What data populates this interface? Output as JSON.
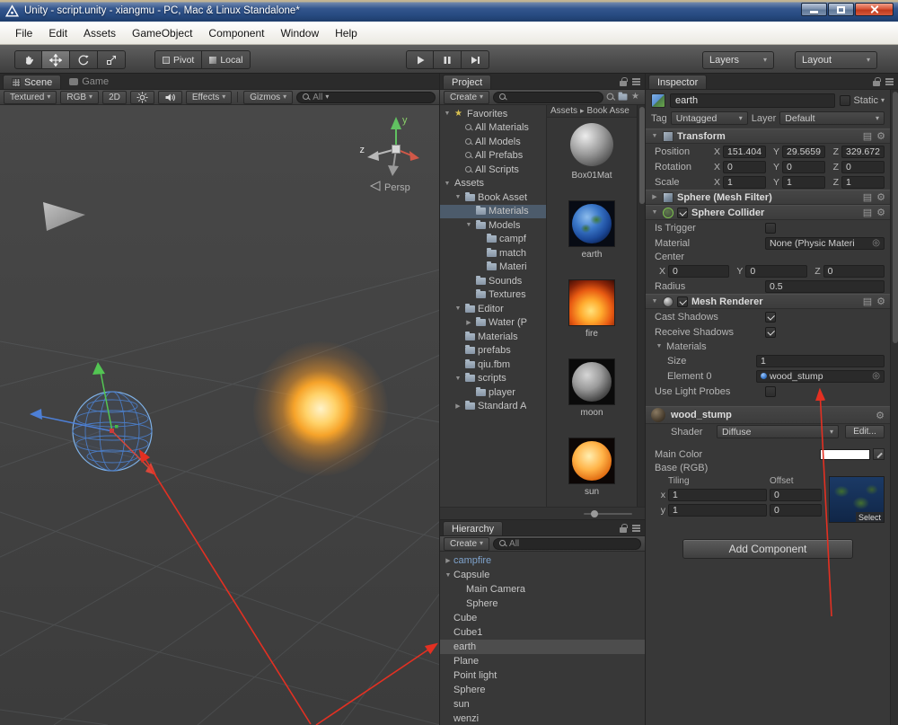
{
  "window": {
    "title": "Unity - script.unity - xiangmu - PC, Mac & Linux Standalone*"
  },
  "icons": {
    "dropdown": "▾",
    "gear": "⚙",
    "book": "▤",
    "picker": "◎",
    "star": "★",
    "breadcrumb_sep": "▸"
  },
  "menu": {
    "items": [
      {
        "label": "File"
      },
      {
        "label": "Edit"
      },
      {
        "label": "Assets"
      },
      {
        "label": "GameObject"
      },
      {
        "label": "Component"
      },
      {
        "label": "Window"
      },
      {
        "label": "Help"
      }
    ]
  },
  "toolbar": {
    "pivot": "Pivot",
    "local": "Local",
    "layers": "Layers",
    "layout": "Layout"
  },
  "scene": {
    "tab_scene": "Scene",
    "tab_game": "Game",
    "btn_textured": "Textured",
    "btn_rgb": "RGB",
    "btn_2d": "2D",
    "btn_effects": "Effects",
    "btn_gizmos": "Gizmos",
    "search": "All",
    "axis_y": "y",
    "axis_z": "z",
    "persp": "Persp"
  },
  "project": {
    "tab": "Project",
    "create": "Create",
    "breadcrumb_root": "Assets",
    "breadcrumb_current": "Book Asse",
    "tree": [
      {
        "label": "Favorites"
      },
      {
        "label": "All Materials"
      },
      {
        "label": "All Models"
      },
      {
        "label": "All Prefabs"
      },
      {
        "label": "All Scripts"
      },
      {
        "label": "Assets"
      },
      {
        "label": "Book Asset"
      },
      {
        "label": "Materials"
      },
      {
        "label": "Models"
      },
      {
        "label": "campf"
      },
      {
        "label": "match"
      },
      {
        "label": "Materi"
      },
      {
        "label": "Sounds"
      },
      {
        "label": "Textures"
      },
      {
        "label": "Editor"
      },
      {
        "label": "Water (P"
      },
      {
        "label": "Materials"
      },
      {
        "label": "prefabs"
      },
      {
        "label": "qiu.fbm"
      },
      {
        "label": "scripts"
      },
      {
        "label": "player"
      },
      {
        "label": "Standard A"
      }
    ],
    "assets": [
      {
        "name": "Box01Mat"
      },
      {
        "name": "earth"
      },
      {
        "name": "fire"
      },
      {
        "name": "moon"
      },
      {
        "name": "sun"
      }
    ]
  },
  "hierarchy": {
    "tab": "Hierarchy",
    "create": "Create",
    "search": "All",
    "items": [
      {
        "label": "campfire"
      },
      {
        "label": "Capsule"
      },
      {
        "label": "Main Camera"
      },
      {
        "label": "Sphere"
      },
      {
        "label": "Cube"
      },
      {
        "label": "Cube1"
      },
      {
        "label": "earth"
      },
      {
        "label": "Plane"
      },
      {
        "label": "Point light"
      },
      {
        "label": "Sphere"
      },
      {
        "label": "sun"
      },
      {
        "label": "wenzi"
      }
    ]
  },
  "inspector": {
    "tab": "Inspector",
    "name": "earth",
    "static_label": "Static",
    "tag_label": "Tag",
    "tag_value": "Untagged",
    "layer_label": "Layer",
    "layer_value": "Default",
    "axis_x": "X",
    "axis_y": "Y",
    "axis_z": "Z",
    "transform": {
      "title": "Transform",
      "position": {
        "label": "Position",
        "x": "151.404",
        "y": "29.5659",
        "z": "329.672"
      },
      "rotation": {
        "label": "Rotation",
        "x": "0",
        "y": "0",
        "z": "0"
      },
      "scale": {
        "label": "Scale",
        "x": "1",
        "y": "1",
        "z": "1"
      }
    },
    "mesh_filter": {
      "title": "Sphere (Mesh Filter)"
    },
    "sphere_collider": {
      "title": "Sphere Collider",
      "is_trigger_label": "Is Trigger",
      "material_label": "Material",
      "material_value": "None (Physic Materi",
      "center_label": "Center",
      "center": {
        "x": "0",
        "y": "0",
        "z": "0"
      },
      "radius_label": "Radius",
      "radius_value": "0.5"
    },
    "mesh_renderer": {
      "title": "Mesh Renderer",
      "cast_label": "Cast Shadows",
      "receive_label": "Receive Shadows",
      "materials_label": "Materials",
      "size_label": "Size",
      "size_value": "1",
      "element_label": "Element 0",
      "element_value": "wood_stump",
      "probes_label": "Use Light Probes"
    },
    "material": {
      "name": "wood_stump",
      "shader_label": "Shader",
      "shader_value": "Diffuse",
      "edit_label": "Edit...",
      "main_color_label": "Main Color",
      "base_label": "Base (RGB)",
      "tiling_label": "Tiling",
      "offset_label": "Offset",
      "x_label": "x",
      "y_label": "y",
      "x_tiling": "1",
      "x_offset": "0",
      "y_tiling": "1",
      "y_offset": "0",
      "select_label": "Select"
    },
    "add_component_label": "Add Component"
  }
}
